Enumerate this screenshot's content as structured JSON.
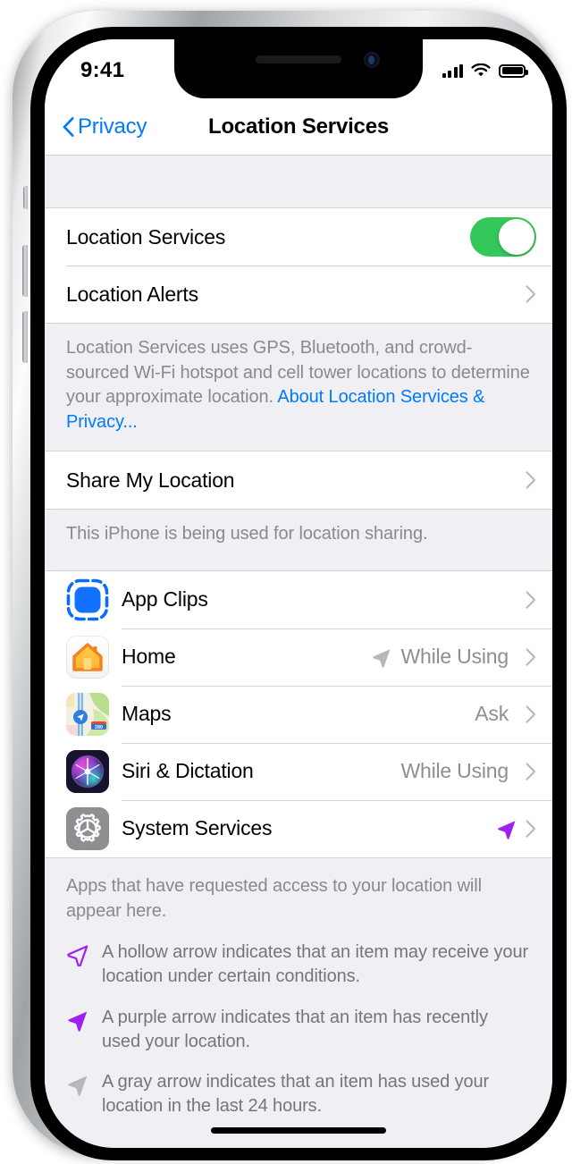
{
  "status_bar": {
    "time": "9:41",
    "signal_icon": "cellular-bars-icon",
    "wifi_icon": "wifi-icon",
    "battery_icon": "battery-full-icon"
  },
  "nav_bar": {
    "back_label": "Privacy",
    "back_icon": "chevron-left-icon",
    "title": "Location Services"
  },
  "main_group": {
    "rows": [
      {
        "label": "Location Services",
        "control": "toggle",
        "toggle_on": true
      },
      {
        "label": "Location Alerts",
        "control": "chevron"
      }
    ],
    "footer_text": "Location Services uses GPS, Bluetooth, and crowd-sourced Wi-Fi hotspot and cell tower locations to determine your approximate location. ",
    "footer_link": "About Location Services & Privacy..."
  },
  "share_group": {
    "row_label": "Share My Location",
    "footer_text": "This iPhone is being used for location sharing."
  },
  "apps_group": {
    "items": [
      {
        "name": "App Clips",
        "icon": "app-clips-icon",
        "value": "",
        "arrow": "none"
      },
      {
        "name": "Home",
        "icon": "home-app-icon",
        "value": "While Using",
        "arrow": "gray-filled"
      },
      {
        "name": "Maps",
        "icon": "maps-app-icon",
        "value": "Ask",
        "arrow": "none"
      },
      {
        "name": "Siri & Dictation",
        "icon": "siri-app-icon",
        "value": "While Using",
        "arrow": "none"
      },
      {
        "name": "System Services",
        "icon": "system-services-icon",
        "value": "",
        "arrow": "purple-filled"
      }
    ],
    "footer_text": "Apps that have requested access to your location will appear here."
  },
  "legend": {
    "items": [
      {
        "arrow": "hollow-purple-arrow-icon",
        "text": "A hollow arrow indicates that an item may receive your location under certain conditions."
      },
      {
        "arrow": "filled-purple-arrow-icon",
        "text": "A purple arrow indicates that an item has recently used your location."
      },
      {
        "arrow": "filled-gray-arrow-icon",
        "text": "A gray arrow indicates that an item has used your location in the last 24 hours."
      }
    ]
  },
  "colors": {
    "accent_blue": "#007aff",
    "toggle_green": "#34c759",
    "arrow_purple": "#a020f0",
    "arrow_gray": "#b6b6bb",
    "group_background": "#efeff4",
    "secondary_text": "#8a8a8e"
  }
}
